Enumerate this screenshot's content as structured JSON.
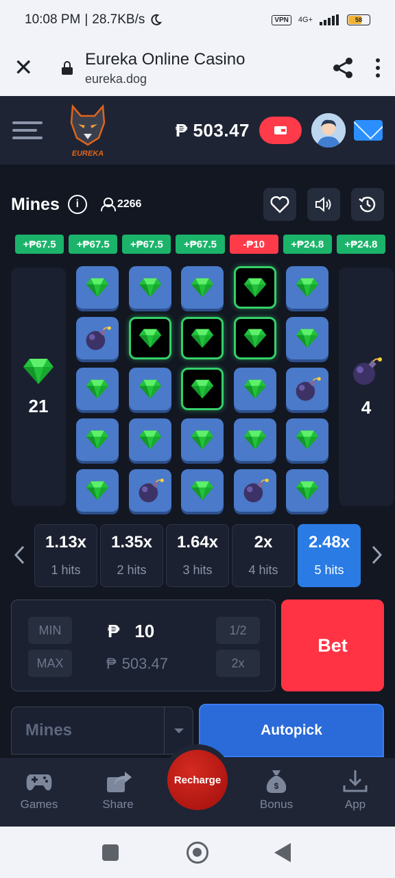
{
  "status_bar": {
    "time": "10:08 PM",
    "speed": "28.7KB/s",
    "vpn": "VPN",
    "network": "4G+",
    "battery": "58"
  },
  "browser": {
    "title": "Eureka Online Casino",
    "url": "eureka.dog"
  },
  "header": {
    "balance_currency": "₱",
    "balance_value": "503.47",
    "logo_text": "EUREKA"
  },
  "game": {
    "title": "Mines",
    "players": "2266",
    "results": [
      {
        "label": "+₱67.5",
        "type": "win"
      },
      {
        "label": "+₱67.5",
        "type": "win"
      },
      {
        "label": "+₱67.5",
        "type": "win"
      },
      {
        "label": "+₱67.5",
        "type": "win"
      },
      {
        "label": "-₱10",
        "type": "loss"
      },
      {
        "label": "+₱24.8",
        "type": "win"
      },
      {
        "label": "+₱24.8",
        "type": "win"
      }
    ],
    "gems_left": "21",
    "mines_count": "4",
    "grid": [
      [
        "gem",
        "gem",
        "gem",
        "gem-open",
        "gem"
      ],
      [
        "bomb",
        "gem-open",
        "gem-open",
        "gem-open",
        "gem"
      ],
      [
        "gem",
        "gem",
        "gem-open",
        "gem",
        "bomb"
      ],
      [
        "gem",
        "gem",
        "gem",
        "gem",
        "gem"
      ],
      [
        "gem",
        "bomb",
        "gem",
        "bomb",
        "gem"
      ]
    ]
  },
  "multipliers": [
    {
      "value": "1.13x",
      "hits": "1 hits"
    },
    {
      "value": "1.35x",
      "hits": "2 hits"
    },
    {
      "value": "1.64x",
      "hits": "3 hits"
    },
    {
      "value": "2x",
      "hits": "4 hits"
    },
    {
      "value": "2.48x",
      "hits": "5 hits",
      "active": true
    }
  ],
  "bet": {
    "min_label": "MIN",
    "max_label": "MAX",
    "currency": "₱",
    "amount": "10",
    "max_amount": "503.47",
    "half_label": "1/2",
    "double_label": "2x",
    "bet_label": "Bet",
    "mode_value": "Mines",
    "autopick_label": "Autopick"
  },
  "nav": {
    "games": "Games",
    "share": "Share",
    "recharge": "Recharge",
    "bonus": "Bonus",
    "app": "App"
  },
  "colors": {
    "win": "#1bb46a",
    "loss": "#ff3b4a",
    "accent": "#2a7be4",
    "bet": "#ff3344"
  }
}
